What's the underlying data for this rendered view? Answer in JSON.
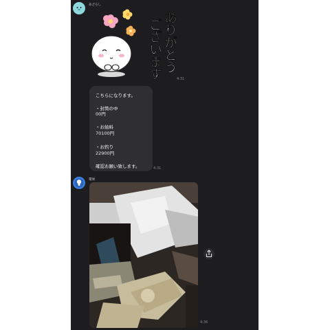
{
  "sender1": {
    "name": "あざらし",
    "time": "4:31"
  },
  "sticker": {
    "line1": "ありがとう",
    "line2": "ございます"
  },
  "message": {
    "lines": [
      "こちらになります。",
      "・封筒の中",
      "00円",
      "・お給料",
      "70100円",
      "・お釣り",
      "22900円",
      "確認お願い致します。"
    ],
    "time": "4:31"
  },
  "sender2": {
    "name": "電球",
    "time": "4:36"
  },
  "colors": {
    "background": "#1d1d1f",
    "bubble": "#2f2f31",
    "avatar1": "#8fd8de",
    "avatar2": "#3b7de0"
  },
  "icons": {
    "share": "share-icon",
    "bulb": "lightbulb-icon"
  }
}
